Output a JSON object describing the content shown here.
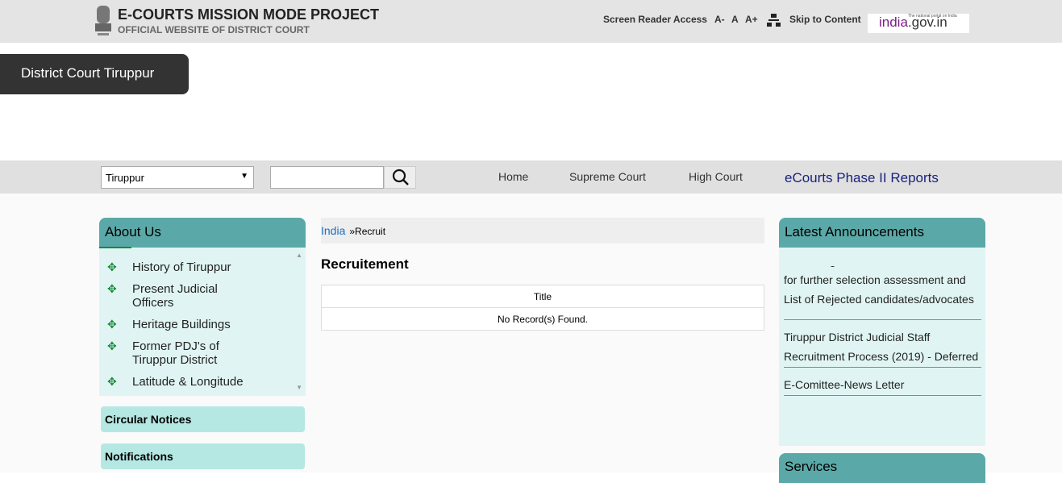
{
  "header": {
    "title": "E-COURTS MISSION MODE PROJECT",
    "subtitle": "OFFICIAL WEBSITE OF DISTRICT COURT",
    "screen_reader": "Screen Reader Access",
    "font_small": "A-",
    "font_normal": "A",
    "font_large": "A+",
    "sitemap_icon": "sitemap-icon",
    "skip": "Skip to Content",
    "india_logo_text": "india.gov.in",
    "india_tagline": "The national portal on India"
  },
  "court_name": "District Court Tiruppur",
  "nav": {
    "district_select": "Tiruppur",
    "search_placeholder": "",
    "links": [
      "Home",
      "Supreme Court",
      "High Court"
    ],
    "ecourts": "eCourts Phase II Reports"
  },
  "about": {
    "title": "About Us",
    "items": [
      "History of Tiruppur",
      "Present Judicial Officers",
      "Heritage Buildings",
      "Former PDJ's of Tiruppur District",
      "Latitude & Longitude"
    ]
  },
  "side_buttons": [
    "Circular Notices",
    "Notifications"
  ],
  "breadcrumb": {
    "root": "India",
    "current": "»Recruit"
  },
  "content": {
    "title": "Recruitement",
    "column": "Title",
    "empty": "No Record(s) Found."
  },
  "announcements": {
    "title": "Latest Announcements",
    "items": [
      "List of Eligible candidates/advocates for further selection assessment and List of Rejected candidates/advocates",
      "Tiruppur District Judicial Staff Recruitment Process (2019) - Deferred",
      "E-Comittee-News Letter"
    ]
  },
  "services": {
    "title": "Services"
  },
  "colors": {
    "teal": "#5aa9a8",
    "panel": "#e0f5f3",
    "link": "#1a237e"
  }
}
